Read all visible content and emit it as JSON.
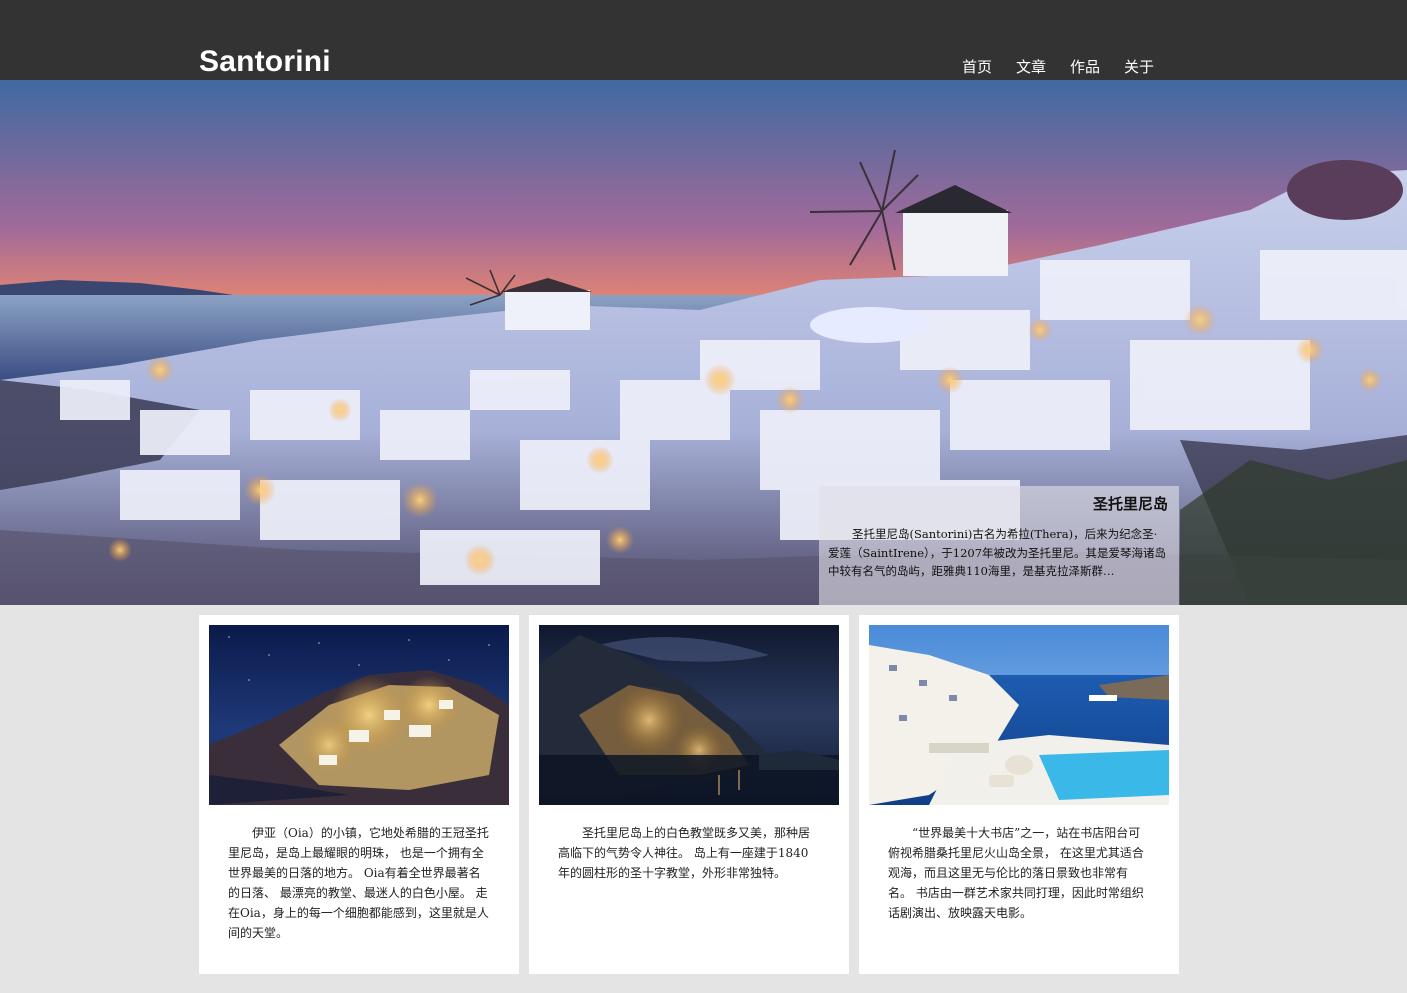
{
  "header": {
    "site_title": "Santorini",
    "nav": [
      {
        "label": "首页"
      },
      {
        "label": "文章"
      },
      {
        "label": "作品"
      },
      {
        "label": "关于"
      }
    ]
  },
  "hero": {
    "image": "santorini-sunset-panorama",
    "caption_title": "圣托里尼岛",
    "caption_text": "圣托里尼岛(Santorini)古名为希拉(Thera)，后来为纪念圣·爱莲（SaintIrene），于1207年被改为圣托里尼。其是爱琴海诸岛中较有名气的岛屿，距雅典110海里，是基克拉泽斯群…"
  },
  "cards": [
    {
      "image": "oia-night-village",
      "text": "伊亚（Oia）的小镇，它地处希腊的王冠圣托里尼岛，是岛上最耀眼的明珠， 也是一个拥有全世界最美的日落的地方。 Oia有着全世界最著名的日落、 最漂亮的教堂、最迷人的白色小屋。 走在Oia，身上的每一个细胞都能感到，这里就是人间的天堂。"
    },
    {
      "image": "cliff-village-night",
      "text": "圣托里尼岛上的白色教堂既多又美，那种居高临下的气势令人神往。 岛上有一座建于1840年的圆柱形的圣十字教堂，外形非常独特。"
    },
    {
      "image": "terrace-pool-sea",
      "text": "“世界最美十大书店”之一，站在书店阳台可俯视希腊桑托里尼火山岛全景， 在这里尤其适合观海，而且这里无与伦比的落日景致也非常有名。 书店由一群艺术家共同打理，因此时常组织话剧演出、放映露天电影。"
    }
  ],
  "colors": {
    "header_bg": "#333333",
    "page_bg": "#e4e4e4",
    "card_bg": "#ffffff"
  }
}
